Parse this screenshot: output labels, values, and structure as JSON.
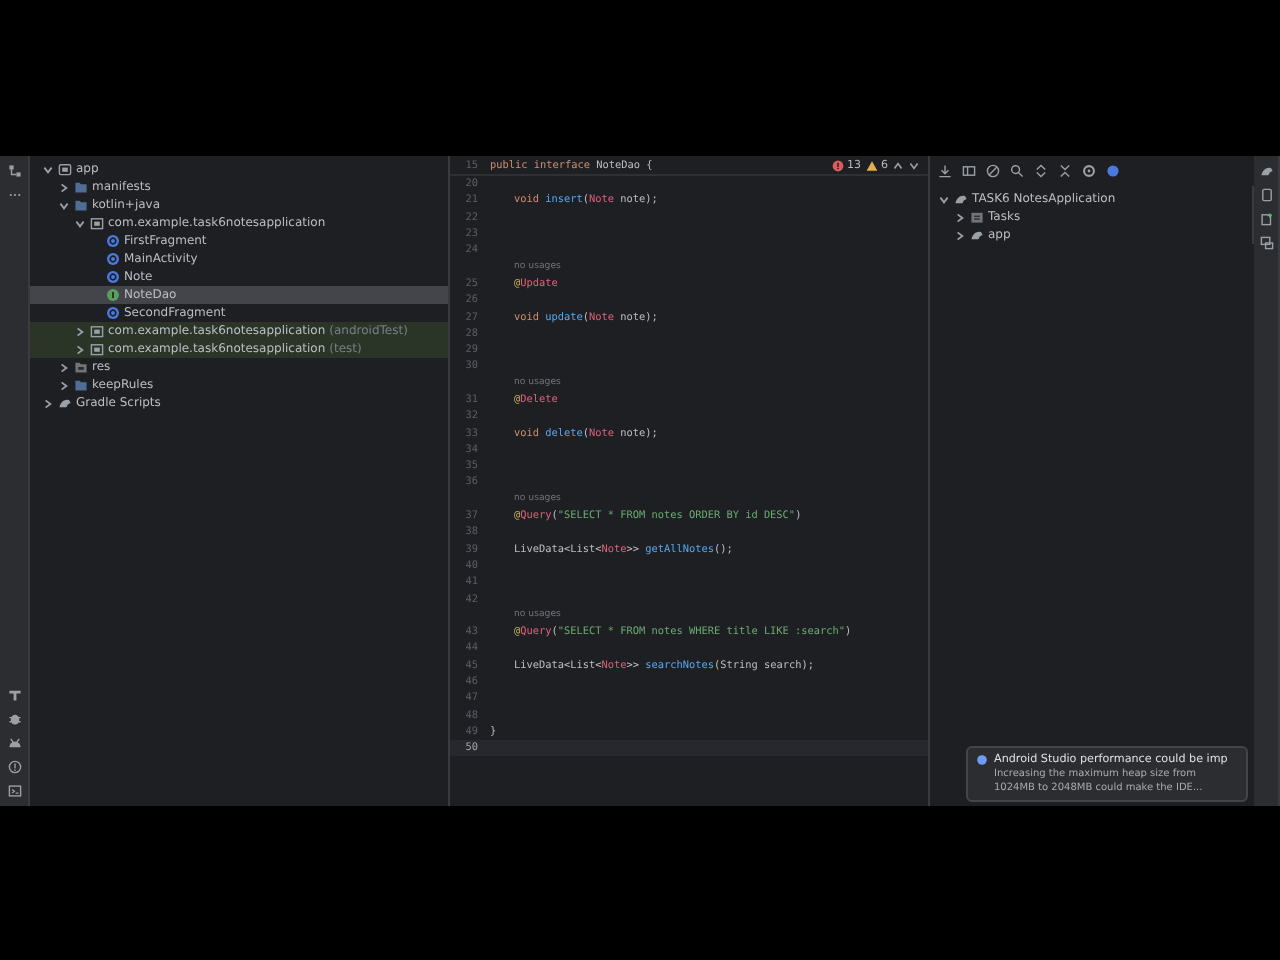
{
  "project_tree": [
    {
      "label": "app",
      "kind": "module",
      "expanded": true,
      "selected": false,
      "highlighted": false,
      "children": [
        {
          "label": "manifests",
          "kind": "folder",
          "expanded": false,
          "selected": false,
          "highlighted": false
        },
        {
          "label": "kotlin+java",
          "kind": "folder",
          "expanded": true,
          "selected": false,
          "highlighted": false,
          "children": [
            {
              "label": "com.example.task6notesapplication",
              "kind": "package",
              "expanded": true,
              "selected": false,
              "highlighted": false,
              "children": [
                {
                  "label": "FirstFragment",
                  "kind": "class",
                  "selected": false,
                  "highlighted": false
                },
                {
                  "label": "MainActivity",
                  "kind": "class",
                  "selected": false,
                  "highlighted": false
                },
                {
                  "label": "Note",
                  "kind": "class",
                  "selected": false,
                  "highlighted": false
                },
                {
                  "label": "NoteDao",
                  "kind": "interface",
                  "selected": true,
                  "highlighted": false
                },
                {
                  "label": "SecondFragment",
                  "kind": "class",
                  "selected": false,
                  "highlighted": false
                }
              ]
            },
            {
              "label": "com.example.task6notesapplication",
              "suffix": "(androidTest)",
              "kind": "package",
              "expanded": false,
              "selected": false,
              "highlighted": true
            },
            {
              "label": "com.example.task6notesapplication",
              "suffix": "(test)",
              "kind": "package",
              "expanded": false,
              "selected": false,
              "highlighted": true
            }
          ]
        },
        {
          "label": "res",
          "kind": "resfolder",
          "expanded": false,
          "selected": false,
          "highlighted": false
        },
        {
          "label": "keepRules",
          "kind": "folder",
          "expanded": false,
          "selected": false,
          "highlighted": false
        }
      ]
    },
    {
      "label": "Gradle Scripts",
      "kind": "gradle",
      "expanded": false,
      "selected": false,
      "highlighted": false
    }
  ],
  "editor": {
    "sticky": {
      "number": "15",
      "tokens": [
        {
          "text": "public interface ",
          "kind": "kw"
        },
        {
          "text": "NoteDao {",
          "kind": "plain"
        }
      ]
    },
    "errors": "13",
    "warnings": "6",
    "lines": [
      {
        "kind": "code",
        "number": "20",
        "current": false
      },
      {
        "kind": "code",
        "number": "21",
        "current": false,
        "tokens": [
          {
            "text": "void ",
            "kind": "kw"
          },
          {
            "text": "insert",
            "kind": "fn"
          },
          {
            "text": "(",
            "kind": "plain"
          },
          {
            "text": "Note",
            "kind": "err"
          },
          {
            "text": " note);",
            "kind": "plain"
          }
        ]
      },
      {
        "kind": "code",
        "number": "22",
        "current": false
      },
      {
        "kind": "code",
        "number": "23",
        "current": false
      },
      {
        "kind": "code",
        "number": "24",
        "current": false
      },
      {
        "kind": "hint",
        "text": "no usages"
      },
      {
        "kind": "code",
        "number": "25",
        "current": false,
        "tokens": [
          {
            "text": "@",
            "kind": "ann"
          },
          {
            "text": "Update",
            "kind": "err"
          }
        ]
      },
      {
        "kind": "code",
        "number": "26",
        "current": false
      },
      {
        "kind": "code",
        "number": "27",
        "current": false,
        "tokens": [
          {
            "text": "void ",
            "kind": "kw"
          },
          {
            "text": "update",
            "kind": "fn"
          },
          {
            "text": "(",
            "kind": "plain"
          },
          {
            "text": "Note",
            "kind": "err"
          },
          {
            "text": " note);",
            "kind": "plain"
          }
        ]
      },
      {
        "kind": "code",
        "number": "28",
        "current": false
      },
      {
        "kind": "code",
        "number": "29",
        "current": false
      },
      {
        "kind": "code",
        "number": "30",
        "current": false
      },
      {
        "kind": "hint",
        "text": "no usages"
      },
      {
        "kind": "code",
        "number": "31",
        "current": false,
        "tokens": [
          {
            "text": "@",
            "kind": "ann"
          },
          {
            "text": "Delete",
            "kind": "err"
          }
        ]
      },
      {
        "kind": "code",
        "number": "32",
        "current": false
      },
      {
        "kind": "code",
        "number": "33",
        "current": false,
        "tokens": [
          {
            "text": "void ",
            "kind": "kw"
          },
          {
            "text": "delete",
            "kind": "fn"
          },
          {
            "text": "(",
            "kind": "plain"
          },
          {
            "text": "Note",
            "kind": "err"
          },
          {
            "text": " note);",
            "kind": "plain"
          }
        ]
      },
      {
        "kind": "code",
        "number": "34",
        "current": false
      },
      {
        "kind": "code",
        "number": "35",
        "current": false
      },
      {
        "kind": "code",
        "number": "36",
        "current": false
      },
      {
        "kind": "hint",
        "text": "no usages"
      },
      {
        "kind": "code",
        "number": "37",
        "current": false,
        "tokens": [
          {
            "text": "@",
            "kind": "ann"
          },
          {
            "text": "Query",
            "kind": "err"
          },
          {
            "text": "(",
            "kind": "plain"
          },
          {
            "text": "\"SELECT * FROM notes ORDER BY id DESC\"",
            "kind": "str"
          },
          {
            "text": ")",
            "kind": "plain"
          }
        ]
      },
      {
        "kind": "code",
        "number": "38",
        "current": false
      },
      {
        "kind": "code",
        "number": "39",
        "current": false,
        "tokens": [
          {
            "text": "LiveData<List<",
            "kind": "plain"
          },
          {
            "text": "Note",
            "kind": "err"
          },
          {
            "text": ">> ",
            "kind": "plain"
          },
          {
            "text": "getAllNotes",
            "kind": "fn"
          },
          {
            "text": "();",
            "kind": "plain"
          }
        ]
      },
      {
        "kind": "code",
        "number": "40",
        "current": false
      },
      {
        "kind": "code",
        "number": "41",
        "current": false
      },
      {
        "kind": "code",
        "number": "42",
        "current": false
      },
      {
        "kind": "hint",
        "text": "no usages"
      },
      {
        "kind": "code",
        "number": "43",
        "current": false,
        "tokens": [
          {
            "text": "@",
            "kind": "ann"
          },
          {
            "text": "Query",
            "kind": "err"
          },
          {
            "text": "(",
            "kind": "plain"
          },
          {
            "text": "\"SELECT * FROM notes WHERE title LIKE :search\"",
            "kind": "str"
          },
          {
            "text": ")",
            "kind": "plain"
          }
        ]
      },
      {
        "kind": "code",
        "number": "44",
        "current": false
      },
      {
        "kind": "code",
        "number": "45",
        "current": false,
        "tokens": [
          {
            "text": "LiveData<List<",
            "kind": "plain"
          },
          {
            "text": "Note",
            "kind": "err"
          },
          {
            "text": ">> ",
            "kind": "plain"
          },
          {
            "text": "searchNotes",
            "kind": "fn"
          },
          {
            "text": "(String search);",
            "kind": "plain"
          }
        ]
      },
      {
        "kind": "code",
        "number": "46",
        "current": false
      },
      {
        "kind": "code",
        "number": "47",
        "current": false
      },
      {
        "kind": "code",
        "number": "48",
        "current": false
      },
      {
        "kind": "code",
        "number": "49",
        "current": false,
        "tokens": [
          {
            "text": "}",
            "kind": "outer"
          }
        ]
      },
      {
        "kind": "code",
        "number": "50",
        "current": true
      }
    ]
  },
  "tasks_tree": [
    {
      "label": "TASK6 NotesApplication",
      "kind": "project",
      "expanded": true,
      "children": [
        {
          "label": "Tasks",
          "kind": "tasks",
          "expanded": false
        },
        {
          "label": "app",
          "kind": "project",
          "expanded": false
        }
      ]
    }
  ],
  "notification": {
    "title": "Android Studio performance could be imp",
    "body": "Increasing the maximum heap size from 1024MB to 2048MB could make the IDE..."
  }
}
